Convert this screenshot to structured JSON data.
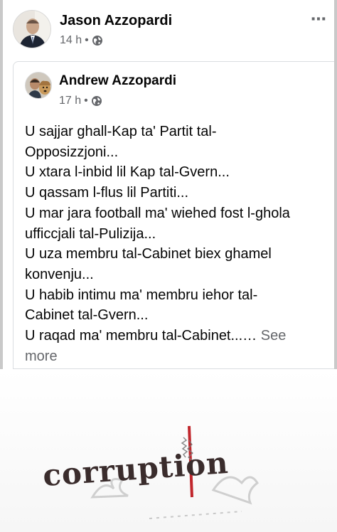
{
  "outer_post": {
    "author": "Jason Azzopardi",
    "time": "14 h",
    "separator": "•",
    "more_icon": "⋯"
  },
  "shared_post": {
    "author": "Andrew Azzopardi",
    "time": "17 h",
    "separator": "•",
    "lines": [
      "U sajjar ghall-Kap ta' Partit tal-",
      "Opposizzjoni...",
      "U xtara l-inbid lil Kap tal-Gvern...",
      "U qassam l-flus lil Partiti...",
      "U mar jara football ma' wiehed fost l-ghola",
      "ufficcjali tal-Pulizija...",
      "U uza membru tal-Cabinet biex ghamel",
      "konvenju...",
      "U habib intimu ma' membru iehor tal-",
      "Cabinet tal-Gvern...",
      "U raqad ma' membru tal-Cabinet...…"
    ],
    "see_more_1": "See",
    "see_more_2": "more"
  },
  "image": {
    "word": "corruption"
  },
  "colors": {
    "text": "#050505",
    "muted": "#65676b",
    "border": "#dadde1",
    "accent_red": "#c1272d"
  },
  "icons": [
    "globe-icon",
    "more-options-icon",
    "avatar"
  ]
}
